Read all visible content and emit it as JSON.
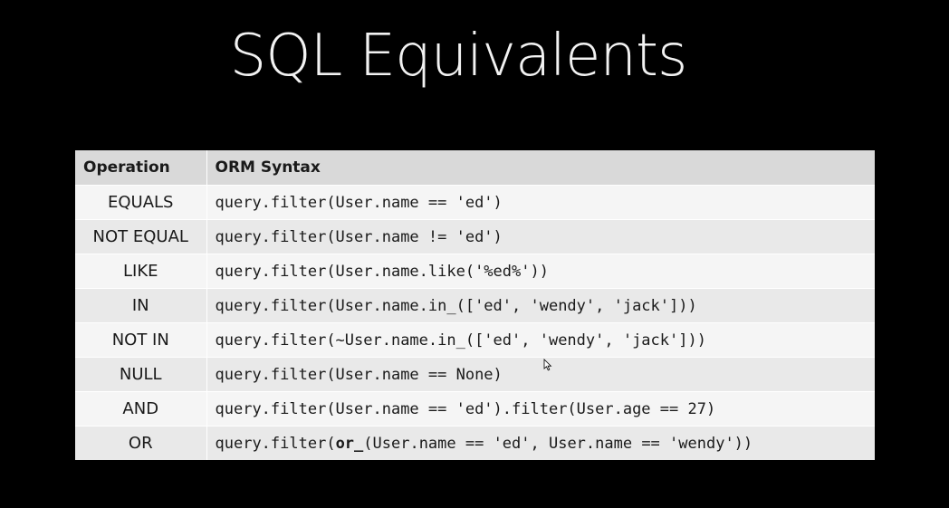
{
  "slide": {
    "title": "SQL Equivalents"
  },
  "table": {
    "headers": {
      "operation": "Operation",
      "syntax": "ORM Syntax"
    },
    "rows": [
      {
        "operation": "EQUALS",
        "syntax": "query.filter(User.name == 'ed')"
      },
      {
        "operation": "NOT EQUAL",
        "syntax": "query.filter(User.name != 'ed')"
      },
      {
        "operation": "LIKE",
        "syntax": "query.filter(User.name.like('%ed%'))"
      },
      {
        "operation": "IN",
        "syntax": "query.filter(User.name.in_(['ed', 'wendy', 'jack']))"
      },
      {
        "operation": "NOT IN",
        "syntax": "query.filter(~User.name.in_(['ed', 'wendy', 'jack']))"
      },
      {
        "operation": "NULL",
        "syntax": "query.filter(User.name == None)"
      },
      {
        "operation": "AND",
        "syntax": "query.filter(User.name == 'ed').filter(User.age == 27)"
      },
      {
        "operation": "OR",
        "syntax_parts": [
          "query.filter(",
          "or_",
          "(User.name == 'ed', User.name == 'wendy'))"
        ]
      }
    ]
  },
  "colors": {
    "background": "#000000",
    "title": "#f2f2f2",
    "header_row": "#d9d9d9",
    "row_odd": "#e9e9e9",
    "row_even": "#f5f5f5",
    "text": "#1a1a1a"
  },
  "icons": {
    "cursor": "mouse-pointer-icon"
  }
}
